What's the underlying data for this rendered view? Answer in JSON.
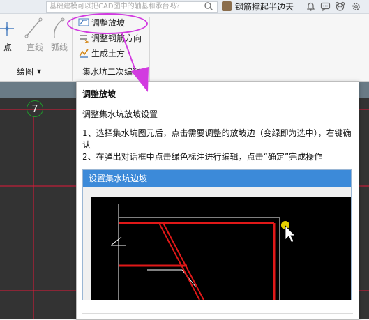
{
  "topbar": {
    "search_text": "基础建模可以把CAD图中的轴基和承台吗？",
    "username": "钢筋撑起半边天",
    "icons": [
      "search-icon",
      "bell-icon",
      "chat-icon",
      "skin-icon",
      "settings-icon"
    ]
  },
  "ribbon": {
    "draw_group": {
      "label": "绘图",
      "buttons": [
        {
          "label": "点",
          "icon": "point-icon"
        },
        {
          "label": "直线",
          "icon": "line-icon"
        },
        {
          "label": "弧线",
          "icon": "arc-icon"
        }
      ]
    },
    "sump_group": {
      "label": "集水坑二次编辑",
      "commands": [
        {
          "label": "调整放坡",
          "icon": "adjust-slope-icon"
        },
        {
          "label": "调整钢筋方向",
          "icon": "rebar-direction-icon"
        },
        {
          "label": "生成土方",
          "icon": "earthwork-icon"
        }
      ]
    }
  },
  "canvas": {
    "axis_label": "7"
  },
  "tooltip": {
    "title": "调整放坡",
    "subtitle": "调整集水坑放坡设置",
    "step1": "1、选择集水坑图元后，点击需要调整的放坡边（变绿即为选中），右键确认",
    "step2": "2、在弹出对话框中点击绿色标注进行编辑，点击“确定”完成操作",
    "preview_title": "设置集水坑边坡"
  },
  "colors": {
    "highlight": "#d23be0",
    "arrow": "#d23be0",
    "preview_header": "#3c8ad9",
    "cad_background": "#333333",
    "grid_line": "#e0183a"
  }
}
